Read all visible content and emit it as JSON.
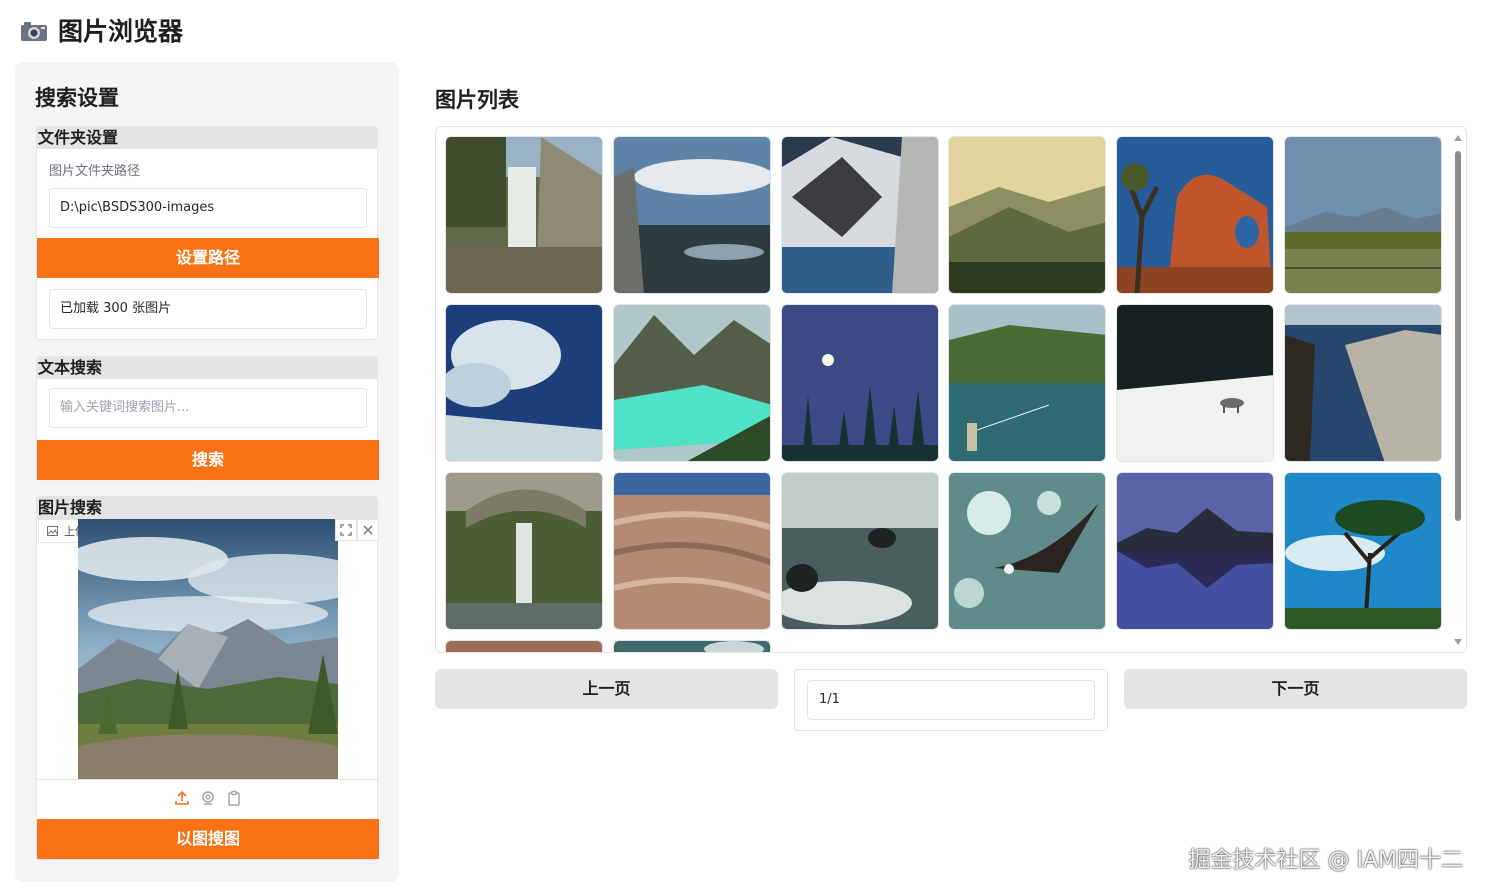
{
  "app": {
    "title": "图片浏览器",
    "title_icon": "camera-icon"
  },
  "left": {
    "heading": "搜索设置",
    "folder": {
      "label": "文件夹设置",
      "path_label": "图片文件夹路径",
      "path_value": "D:\\pic\\BSDS300-images",
      "set_button": "设置路径",
      "status": "已加载 300 张图片"
    },
    "text_search": {
      "label": "文本搜索",
      "placeholder": "输入关键词搜索图片...",
      "button": "搜索"
    },
    "image_search": {
      "label": "图片搜索",
      "upload_label": "上传搜索图片",
      "button": "以图搜图"
    }
  },
  "right": {
    "heading": "图片列表",
    "prev_button": "上一页",
    "next_button": "下一页",
    "page_value": "1/1"
  },
  "gallery": [
    {
      "name": "waterfall-cliff"
    },
    {
      "name": "rock-lake-clouds"
    },
    {
      "name": "snowy-mountains"
    },
    {
      "name": "hazy-hills"
    },
    {
      "name": "red-rock-arch"
    },
    {
      "name": "mountain-meadow"
    },
    {
      "name": "cloudy-sky-snow"
    },
    {
      "name": "turquoise-lake"
    },
    {
      "name": "moon-night-trees"
    },
    {
      "name": "fisherman-lake"
    },
    {
      "name": "wolf-in-snow"
    },
    {
      "name": "rocky-coast"
    },
    {
      "name": "bridge-waterfall"
    },
    {
      "name": "layered-rocks"
    },
    {
      "name": "sea-rocks"
    },
    {
      "name": "eagle-flying"
    },
    {
      "name": "reflection-lake"
    },
    {
      "name": "tree-sky"
    }
  ],
  "watermark": "掘金技术社区 @ IAM四十二",
  "colors": {
    "accent": "#f97316",
    "panel": "#f4f4f5",
    "border": "#e4e4e7"
  }
}
